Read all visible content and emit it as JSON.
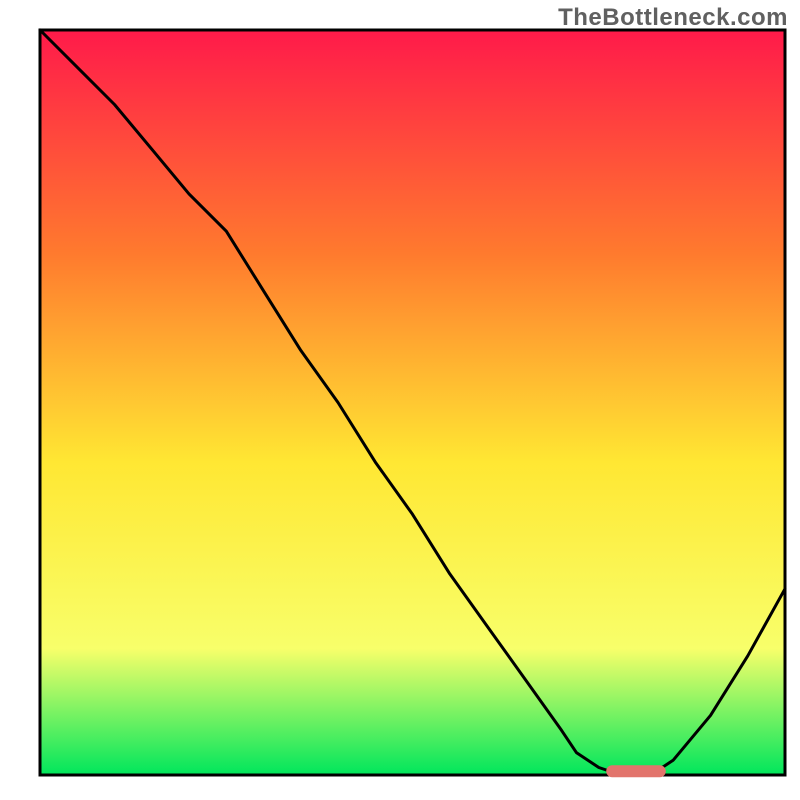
{
  "watermark": "TheBottleneck.com",
  "colors": {
    "gradient_top": "#ff1a4a",
    "gradient_mid1": "#ff7a2e",
    "gradient_mid2": "#ffe733",
    "gradient_mid3": "#f8ff6a",
    "gradient_bottom": "#00e65c",
    "border": "#000000",
    "curve": "#000000",
    "marker": "#e2746c"
  },
  "chart_data": {
    "type": "line",
    "title": "",
    "xlabel": "",
    "ylabel": "",
    "xlim": [
      0,
      100
    ],
    "ylim": [
      0,
      100
    ],
    "grid": false,
    "legend": false,
    "x": [
      0,
      5,
      10,
      15,
      20,
      25,
      30,
      35,
      40,
      45,
      50,
      55,
      60,
      65,
      70,
      72,
      75,
      78,
      80,
      82,
      85,
      90,
      95,
      100
    ],
    "values": [
      100,
      95,
      90,
      84,
      78,
      73,
      65,
      57,
      50,
      42,
      35,
      27,
      20,
      13,
      6,
      3,
      1,
      0,
      0,
      0,
      2,
      8,
      16,
      25
    ],
    "minimum_mark_x_range": [
      76,
      84
    ],
    "minimum_mark_y": 0.5
  }
}
